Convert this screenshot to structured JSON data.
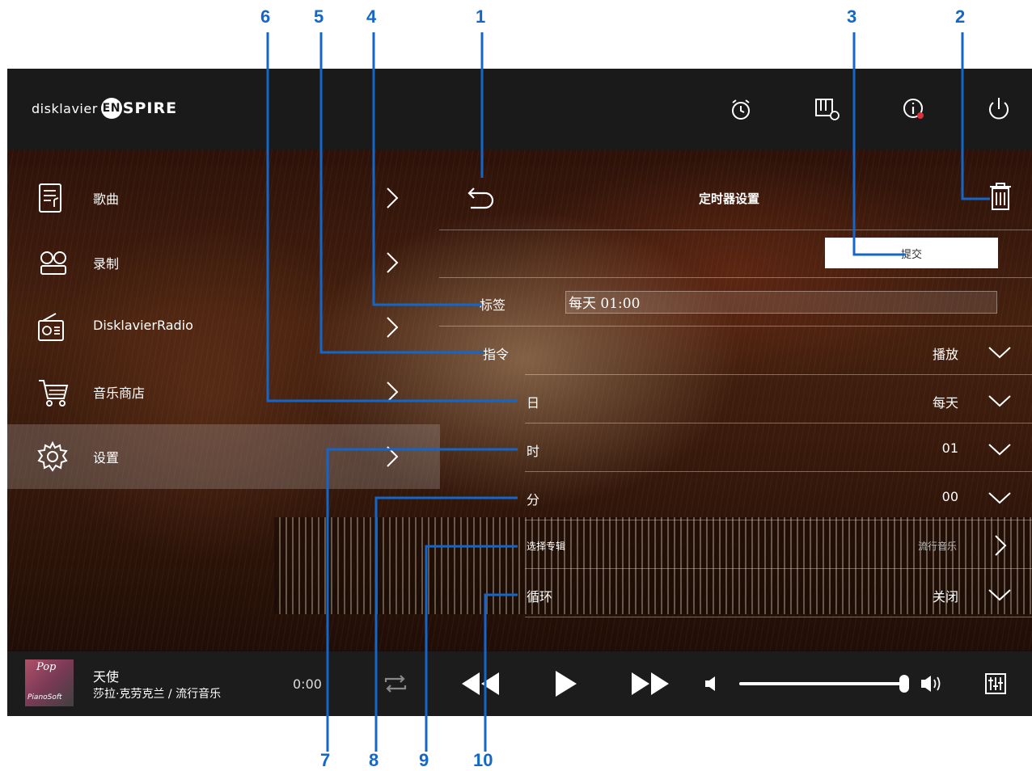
{
  "app": {
    "logo_prefix": "disklavier",
    "logo_badge": "EN",
    "logo_suffix": "SPIRE"
  },
  "header_icons": [
    "alarm-clock-icon",
    "piano-settings-icon",
    "info-icon",
    "power-icon"
  ],
  "sidebar": {
    "items": [
      {
        "label": "歌曲",
        "icon": "songs-icon"
      },
      {
        "label": "录制",
        "icon": "record-reel-icon"
      },
      {
        "label": "DisklavierRadio",
        "icon": "radio-icon"
      },
      {
        "label": "音乐商店",
        "icon": "shopping-cart-icon"
      },
      {
        "label": "设置",
        "icon": "gear-icon",
        "active": true
      }
    ]
  },
  "panel": {
    "title": "定时器设置",
    "submit_label": "提交",
    "label_field": {
      "label": "标签",
      "value": "每天 01:00"
    },
    "rows": [
      {
        "label": "指令",
        "value": "播放"
      },
      {
        "label": "日",
        "value": "每天"
      },
      {
        "label": "时",
        "value": "01"
      },
      {
        "label": "分",
        "value": "00"
      },
      {
        "label": "选择专辑",
        "value": "流行音乐"
      },
      {
        "label": "循环",
        "value": "关闭"
      }
    ]
  },
  "player": {
    "album_text": "Pop",
    "album_brand": "PianoSoft",
    "title": "天使",
    "subtitle": "莎拉·克劳克兰 / 流行音乐",
    "time": "0:00",
    "volume_level": 0.97
  },
  "annotations": [
    "1",
    "2",
    "3",
    "4",
    "5",
    "6",
    "7",
    "8",
    "9",
    "10"
  ],
  "colors": {
    "annotation": "#1466c8"
  }
}
